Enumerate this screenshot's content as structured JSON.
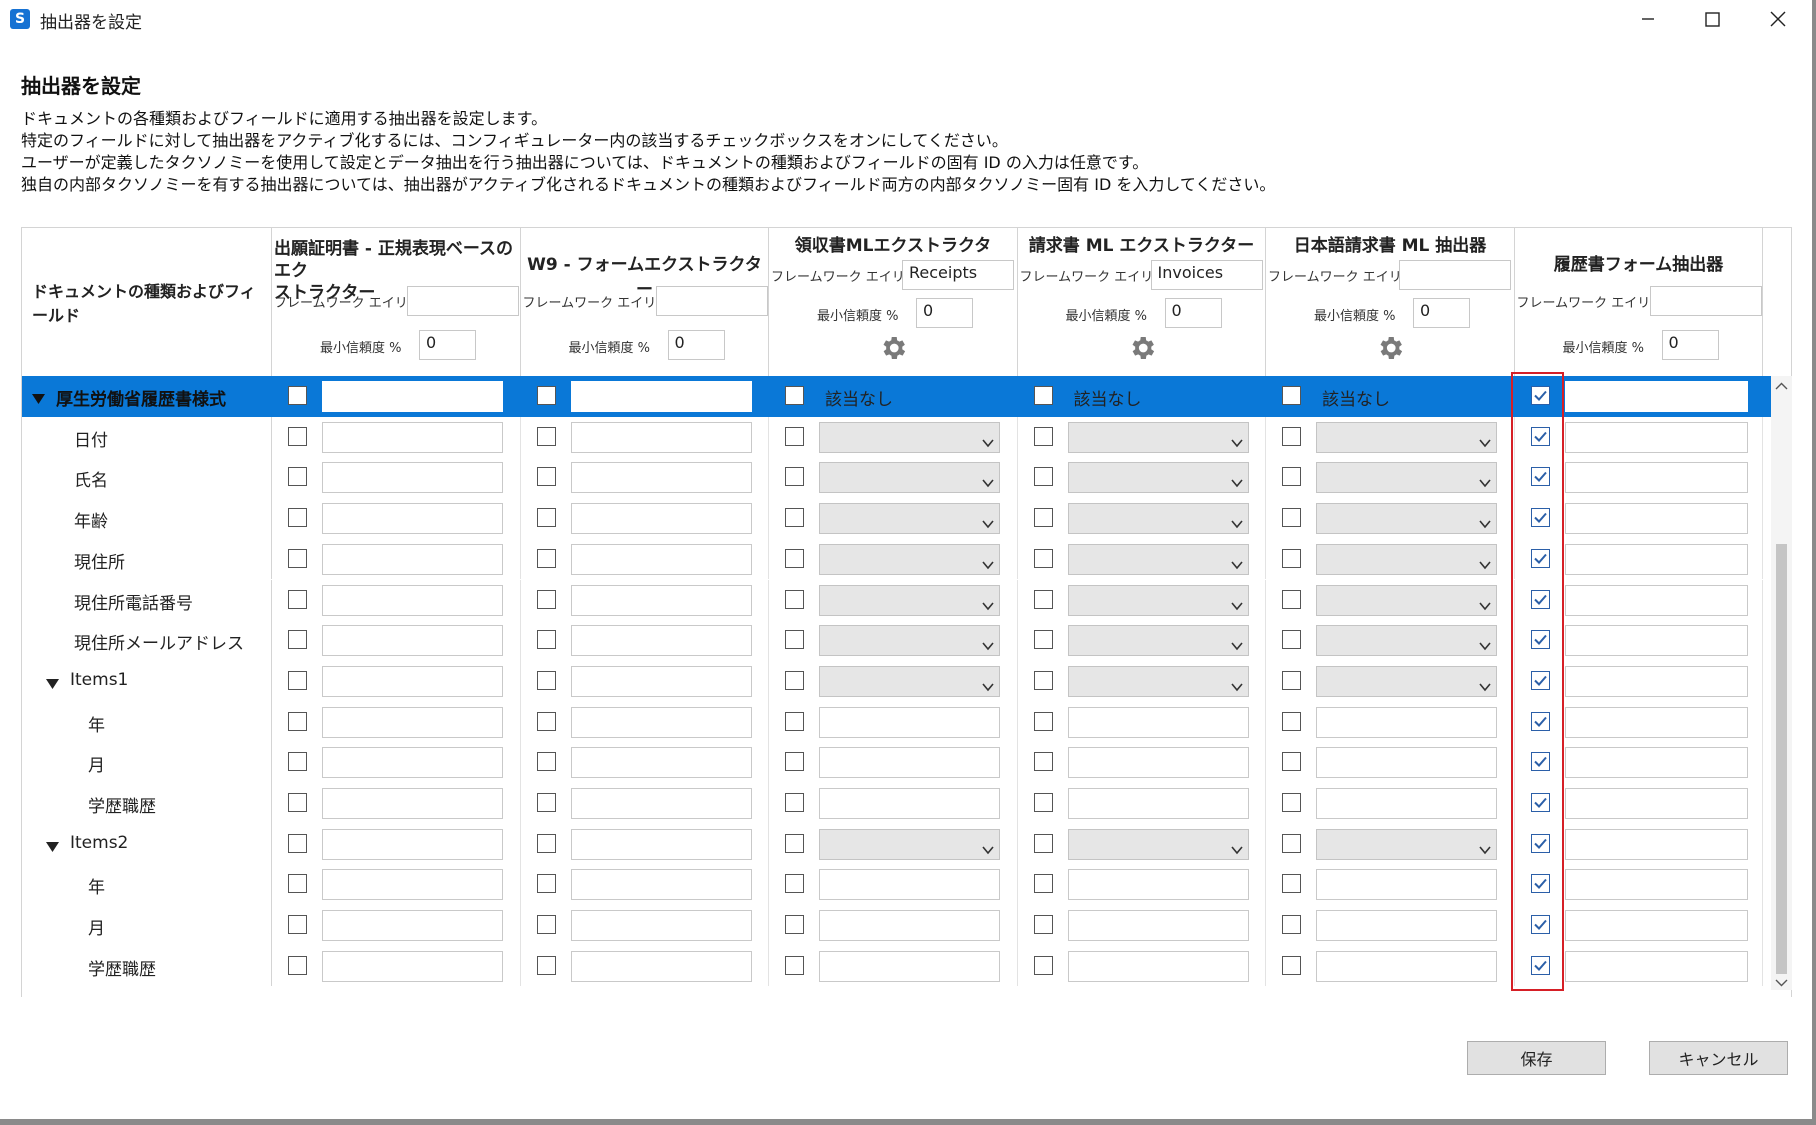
{
  "window": {
    "title": "抽出器を設定"
  },
  "heading": "抽出器を設定",
  "description": [
    "ドキュメントの各種類およびフィールドに適用する抽出器を設定します。",
    "特定のフィールドに対して抽出器をアクティブ化するには、コンフィギュレーター内の該当するチェックボックスをオンにしてください。",
    "ユーザーが定義したタクソノミーを使用して設定とデータ抽出を行う抽出器については、ドキュメントの種類およびフィールドの固有 ID の入力は任意です。",
    "独自の内部タクソノミーを有する抽出器については、抽出器がアクティブ化されるドキュメントの種類およびフィールド両方の内部タクソノミー固有 ID を入力してください。"
  ],
  "table": {
    "first_col_header": "ドキュメントの種類およびフィールド",
    "alias_label": "フレームワーク エイリアス",
    "confidence_label": "最小信頼度 %",
    "na_text": "該当なし",
    "extractors": [
      {
        "title_line1": "出願証明書 - 正規表現ベースのエク",
        "title_line2": "ストラクター",
        "alias": "",
        "confidence": "0",
        "gear": false,
        "combo": false
      },
      {
        "title_line1": "W9 - フォームエクストラクター",
        "title_line2": "",
        "alias": "",
        "confidence": "0",
        "gear": false,
        "combo": false
      },
      {
        "title_line1": "領収書MLエクストラクタ",
        "title_line2": "",
        "alias": "Receipts",
        "confidence": "0",
        "gear": true,
        "combo": true
      },
      {
        "title_line1": "請求書 ML エクストラクター",
        "title_line2": "",
        "alias": "Invoices",
        "confidence": "0",
        "gear": true,
        "combo": true
      },
      {
        "title_line1": "日本語請求書 ML 抽出器",
        "title_line2": "",
        "alias": "",
        "confidence": "0",
        "gear": true,
        "combo": true
      },
      {
        "title_line1": "履歴書フォーム抽出器",
        "title_line2": "",
        "alias": "",
        "confidence": "0",
        "gear": false,
        "combo": false
      }
    ],
    "rows": [
      {
        "label": "厚生労働省履歴書様式",
        "level": 0,
        "expander": true,
        "selected": true,
        "type": "doc"
      },
      {
        "label": "日付",
        "level": 1,
        "expander": false,
        "selected": false,
        "type": "field"
      },
      {
        "label": "氏名",
        "level": 1,
        "expander": false,
        "selected": false,
        "type": "field"
      },
      {
        "label": "年齢",
        "level": 1,
        "expander": false,
        "selected": false,
        "type": "field"
      },
      {
        "label": "現住所",
        "level": 1,
        "expander": false,
        "selected": false,
        "type": "field"
      },
      {
        "label": "現住所電話番号",
        "level": 1,
        "expander": false,
        "selected": false,
        "type": "field"
      },
      {
        "label": "現住所メールアドレス",
        "level": 1,
        "expander": false,
        "selected": false,
        "type": "field"
      },
      {
        "label": "Items1",
        "level": 1,
        "expander": true,
        "selected": false,
        "type": "field"
      },
      {
        "label": "年",
        "level": 2,
        "expander": false,
        "selected": false,
        "type": "sub"
      },
      {
        "label": "月",
        "level": 2,
        "expander": false,
        "selected": false,
        "type": "sub"
      },
      {
        "label": "学歴職歴",
        "level": 2,
        "expander": false,
        "selected": false,
        "type": "sub"
      },
      {
        "label": "Items2",
        "level": 1,
        "expander": true,
        "selected": false,
        "type": "field"
      },
      {
        "label": "年",
        "level": 2,
        "expander": false,
        "selected": false,
        "type": "sub"
      },
      {
        "label": "月",
        "level": 2,
        "expander": false,
        "selected": false,
        "type": "sub"
      },
      {
        "label": "学歴職歴",
        "level": 2,
        "expander": false,
        "selected": false,
        "type": "sub"
      }
    ],
    "last_column_checked": true
  },
  "buttons": {
    "save": "保存",
    "cancel": "キャンセル"
  },
  "colors": {
    "accent": "#0a78d7",
    "highlight_border": "#d61f26"
  },
  "icons": {
    "app": "app-logo-icon",
    "minimize": "minimize-icon",
    "maximize": "maximize-icon",
    "close": "close-icon",
    "gear": "gear-icon",
    "checkmark": "checkmark-icon",
    "expander": "expander-down-icon",
    "dropdown": "chevron-down-icon"
  }
}
